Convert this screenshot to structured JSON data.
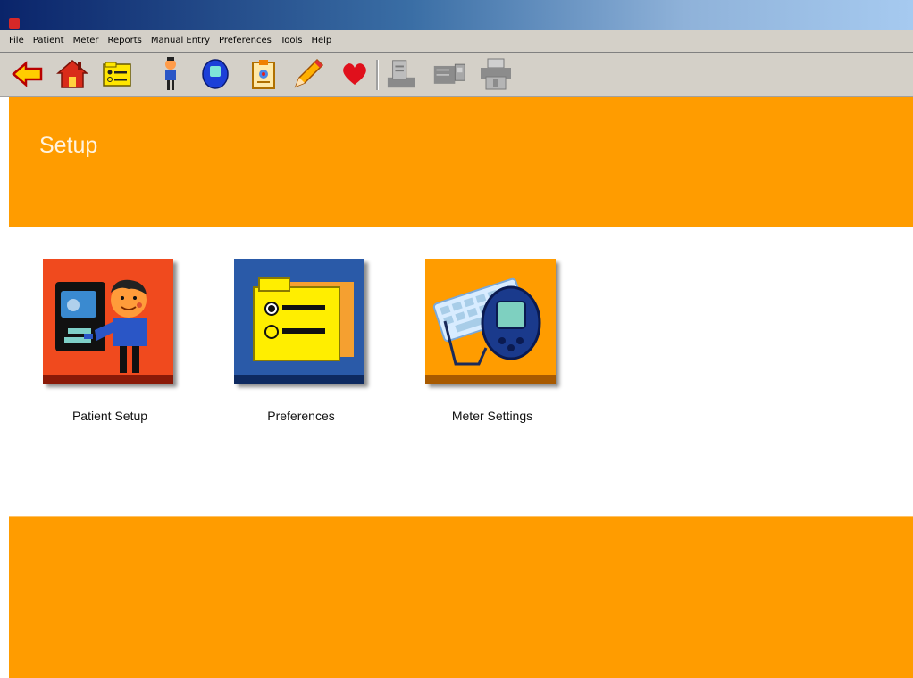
{
  "menu": [
    "File",
    "Patient",
    "Meter",
    "Reports",
    "Manual Entry",
    "Preferences",
    "Tools",
    "Help"
  ],
  "toolbar_icons": [
    "back-arrow-icon",
    "home-icon",
    "preferences-icon",
    "patient-icon",
    "meter-icon",
    "logbook-icon",
    "pencil-icon",
    "heart-icon",
    "download-icon",
    "meter-device-icon",
    "printer-icon"
  ],
  "header": {
    "title": "Setup"
  },
  "tiles": [
    {
      "label": "Patient Setup",
      "icon": "patient-setup-icon"
    },
    {
      "label": "Preferences",
      "icon": "preferences-icon"
    },
    {
      "label": "Meter Settings",
      "icon": "meter-settings-icon"
    }
  ],
  "colors": {
    "accent": "#ff9c00",
    "toolbar": "#d4d0c8",
    "title_bar": "#0a246a"
  }
}
